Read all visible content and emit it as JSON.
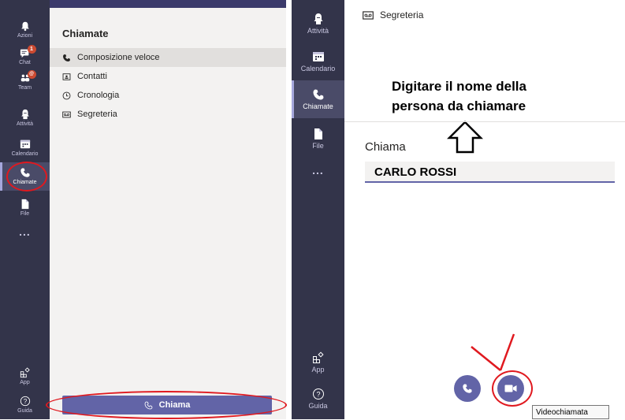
{
  "left_rail": {
    "items": [
      {
        "label": "Azioni",
        "icon": "bell-icon"
      },
      {
        "label": "Chat",
        "icon": "chat-icon",
        "badge": "1"
      },
      {
        "label": "Team",
        "icon": "teams-icon",
        "badge": "@"
      },
      {
        "label": "Attività",
        "icon": "activity-icon"
      },
      {
        "label": "Calendario",
        "icon": "calendar-icon"
      },
      {
        "label": "Chiamate",
        "icon": "phone-icon"
      },
      {
        "label": "File",
        "icon": "file-icon"
      },
      {
        "label": "...",
        "icon": "more-icon"
      },
      {
        "label": "App",
        "icon": "apps-icon"
      },
      {
        "label": "Guida",
        "icon": "help-icon"
      }
    ]
  },
  "calls_panel": {
    "title": "Chiamate",
    "nav": [
      {
        "label": "Composizione veloce",
        "icon": "phone-icon"
      },
      {
        "label": "Contatti",
        "icon": "contact-card-icon"
      },
      {
        "label": "Cronologia",
        "icon": "clock-icon"
      },
      {
        "label": "Segreteria",
        "icon": "voicemail-icon"
      }
    ],
    "call_button": "Chiama"
  },
  "right_rail": {
    "items": [
      {
        "label": "Attività",
        "icon": "activity-icon"
      },
      {
        "label": "Calendario",
        "icon": "calendar-icon"
      },
      {
        "label": "Chiamate",
        "icon": "phone-icon"
      },
      {
        "label": "File",
        "icon": "file-icon"
      },
      {
        "label": "...",
        "icon": "more-icon"
      },
      {
        "label": "App",
        "icon": "apps-icon"
      },
      {
        "label": "Guida",
        "icon": "help-icon"
      }
    ]
  },
  "dial_pane": {
    "voicemail_label": "Segreteria",
    "annotation_line1": "Digitare il nome della",
    "annotation_line2": "persona da chiamare",
    "field_label": "Chiama",
    "field_value": "CARLO ROSSI",
    "tooltip": "Videochiamata"
  },
  "colors": {
    "rail": "#33344a",
    "accent": "#6264a7",
    "highlight": "#e0191f"
  }
}
